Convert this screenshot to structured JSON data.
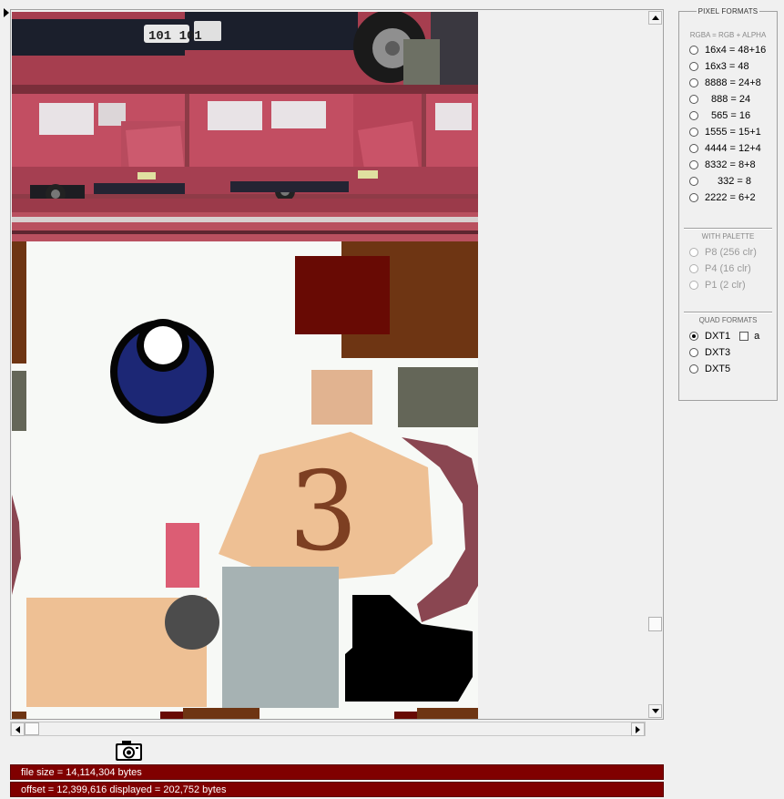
{
  "panel": {
    "pixel_formats_title": "PIXEL FORMATS",
    "rgba_caption": "RGBA = RGB + ALPHA",
    "pixel_options": [
      "16x4 = 48+16",
      "16x3 = 48",
      "8888 = 24+8",
      "888 = 24",
      "565 = 16",
      "1555 = 15+1",
      "4444 = 12+4",
      "8332 = 8+8",
      "332 = 8",
      "2222 = 6+2"
    ],
    "palette_title": "WITH PALETTE",
    "palette_options": [
      "P8  (256 clr)",
      "P4  (16 clr)",
      "P1  (2 clr)"
    ],
    "quad_title": "QUAD FORMATS",
    "quad_options": [
      "DXT1",
      "DXT3",
      "DXT5"
    ],
    "alpha_checkbox_label": "a",
    "selected_format": "DXT1"
  },
  "status": {
    "file_size": "file size = 14,114,304 bytes",
    "offset": "offset = 12,399,616   displayed = 202,752 bytes"
  },
  "texture_text": {
    "number": "3",
    "plate": "101  101"
  },
  "colors": {
    "status_bg": "#800000",
    "car_red": "#b5485a",
    "navy": "#1a237e",
    "skin": "#ecc090",
    "brown": "#6e3513"
  }
}
